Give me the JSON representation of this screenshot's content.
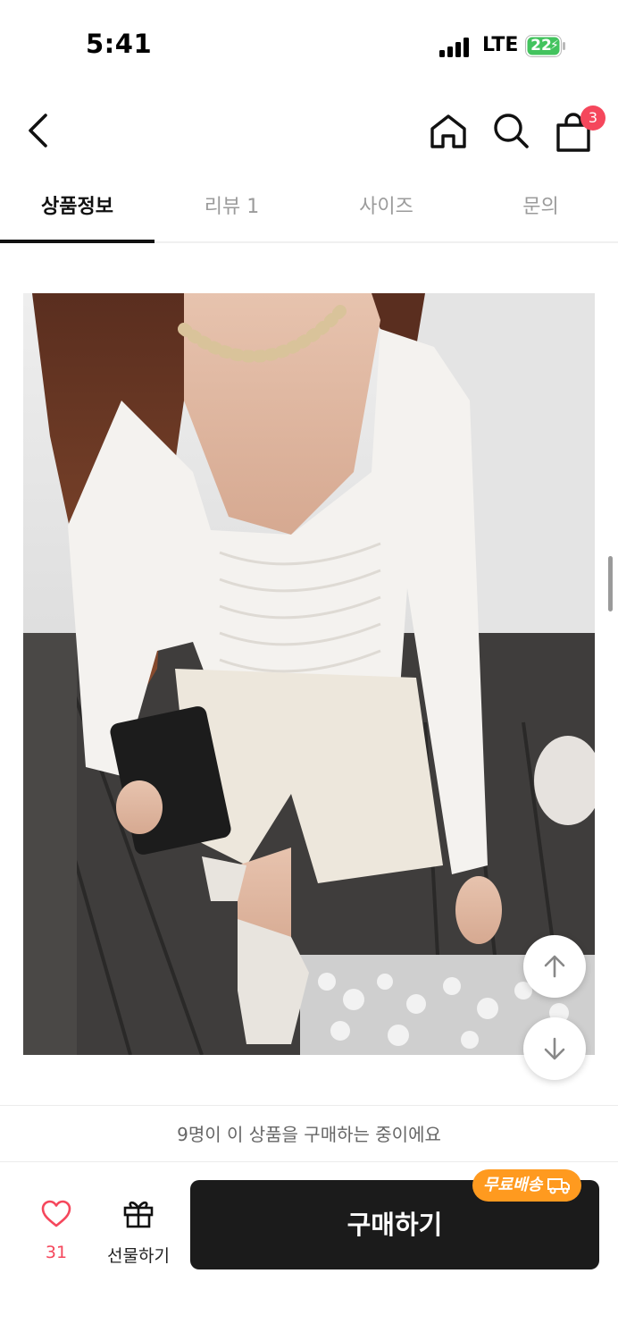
{
  "status_bar": {
    "time": "5:41",
    "network": "LTE",
    "battery": "22"
  },
  "header": {
    "back_icon": "chevron-left-icon",
    "home_icon": "home-icon",
    "search_icon": "search-icon",
    "cart_icon": "shopping-bag-icon",
    "cart_count": "3",
    "badge_color": "#f5475c"
  },
  "tabs": [
    {
      "label": "상품정보",
      "active": true
    },
    {
      "label": "리뷰 1",
      "active": false
    },
    {
      "label": "사이즈",
      "active": false
    },
    {
      "label": "문의",
      "active": false
    }
  ],
  "buying_now_text": "9명이 이 상품을 구매하는 중이에요",
  "bottom_bar": {
    "like_count": "31",
    "gift_label": "선물하기",
    "buy_label": "구매하기",
    "free_shipping_label": "무료배송",
    "accent_color": "#ff9a1f",
    "buy_button_color": "#1b1b1b"
  }
}
